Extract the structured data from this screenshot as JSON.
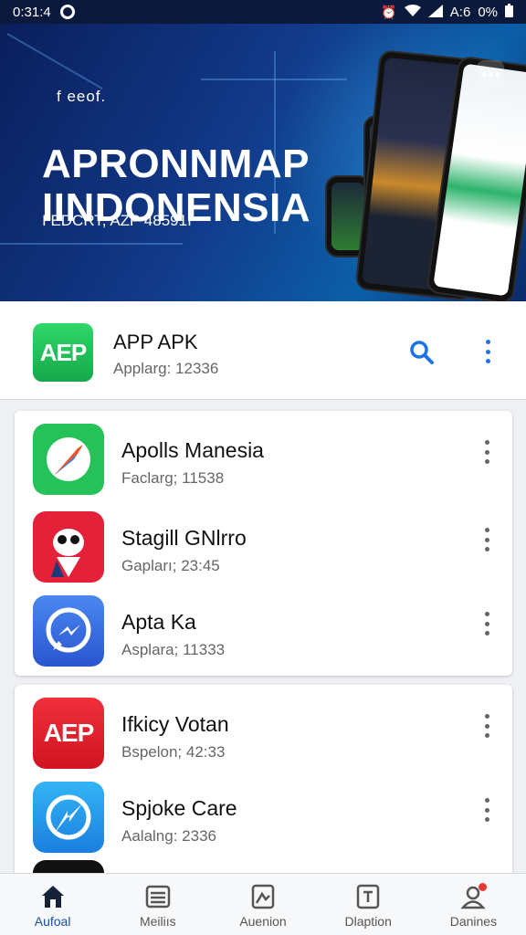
{
  "status_bar": {
    "time": "0:31:4",
    "right_text": "A:6",
    "battery": "0%"
  },
  "banner": {
    "small_text": "f eeof.",
    "title_line1": "APRONNMAP",
    "title_line2": "IINDONENSIA",
    "subtitle": "I EDCRT, AZP 48591I"
  },
  "app_header": {
    "logo_text": "AEP",
    "name": "APP APK",
    "subtitle": "Applarg: 12336"
  },
  "card1": [
    {
      "name": "Apolls Manesia",
      "sub": "Faclarg; 11538",
      "icon": "compass-icon",
      "color": "#25c25a"
    },
    {
      "name": "Stagill GNlrro",
      "sub": "Gapları; 23:45",
      "icon": "mascot-icon",
      "color": "#e5213a"
    },
    {
      "name": "Apta Ka",
      "sub": "Asplara; 11333",
      "icon": "messenger-icon",
      "color": "#3b6fe0"
    }
  ],
  "card2": [
    {
      "name": "Ifkicy Votan",
      "sub": "Bspelon; 42:33",
      "icon": "aep-icon",
      "color": "#e81e2d",
      "logo_text": "AEP"
    },
    {
      "name": "Spjoke Care",
      "sub": "Aalalng: 2336",
      "icon": "lightning-icon",
      "color": "#1e9ae8"
    }
  ],
  "bottom_nav": [
    {
      "label": "Aufoal",
      "icon": "home-icon",
      "active": true
    },
    {
      "label": "Meiliıs",
      "icon": "list-icon",
      "active": false
    },
    {
      "label": "Auenion",
      "icon": "image-icon",
      "active": false
    },
    {
      "label": "Dlaption",
      "icon": "tablet-icon",
      "active": false
    },
    {
      "label": "Danines",
      "icon": "profile-icon",
      "active": false
    }
  ],
  "colors": {
    "accent": "#1a73e8",
    "banner_bg": "#0a1f5c",
    "active_nav": "#1a4fa8"
  }
}
